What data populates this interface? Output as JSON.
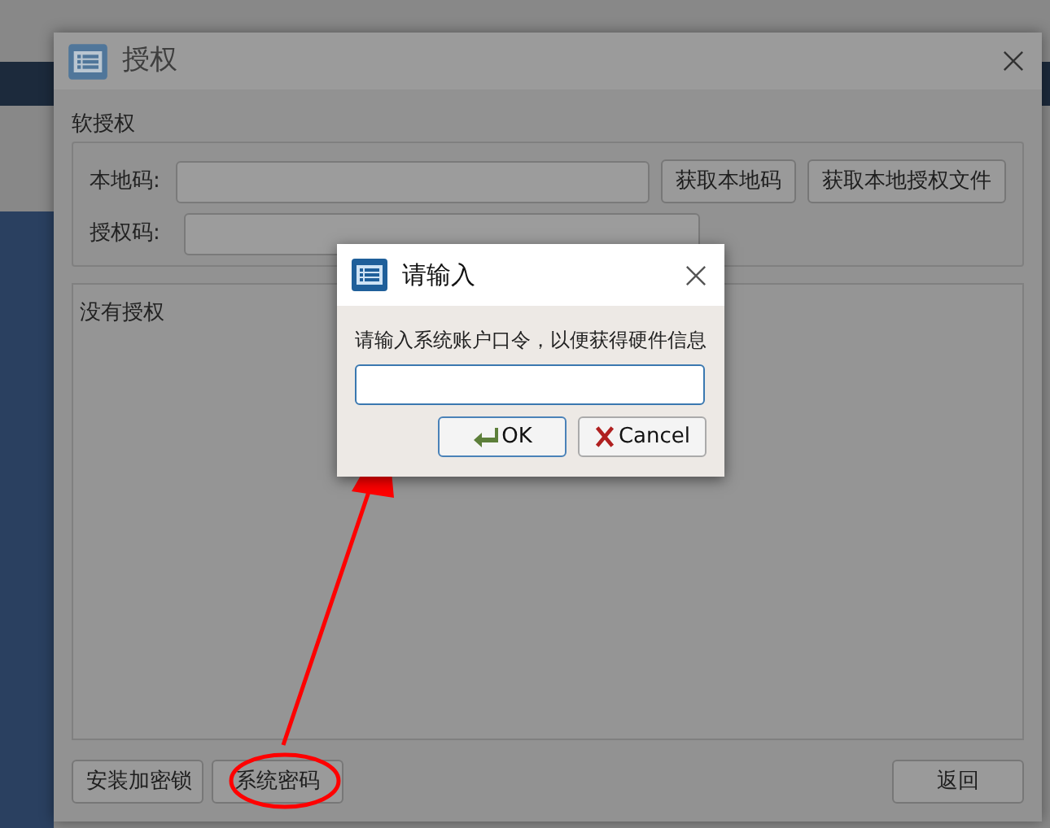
{
  "auth_dialog": {
    "title": "授权",
    "section_title": "软授权",
    "fields": [
      {
        "label": "本地码:"
      },
      {
        "label": "授权码:"
      }
    ],
    "top_buttons": [
      "获取本地码",
      "获取本地授权文件"
    ],
    "message": "没有授权",
    "bottom_buttons": [
      {
        "label": "安装加密锁",
        "highlighted": false
      },
      {
        "label": "系统密码",
        "highlighted": true
      }
    ],
    "back_button": "返回"
  },
  "input_dialog": {
    "title": "请输入",
    "prompt": "请输入系统账户口令，以便获得硬件信息",
    "ok_button": "OK",
    "cancel_button": "Cancel"
  }
}
